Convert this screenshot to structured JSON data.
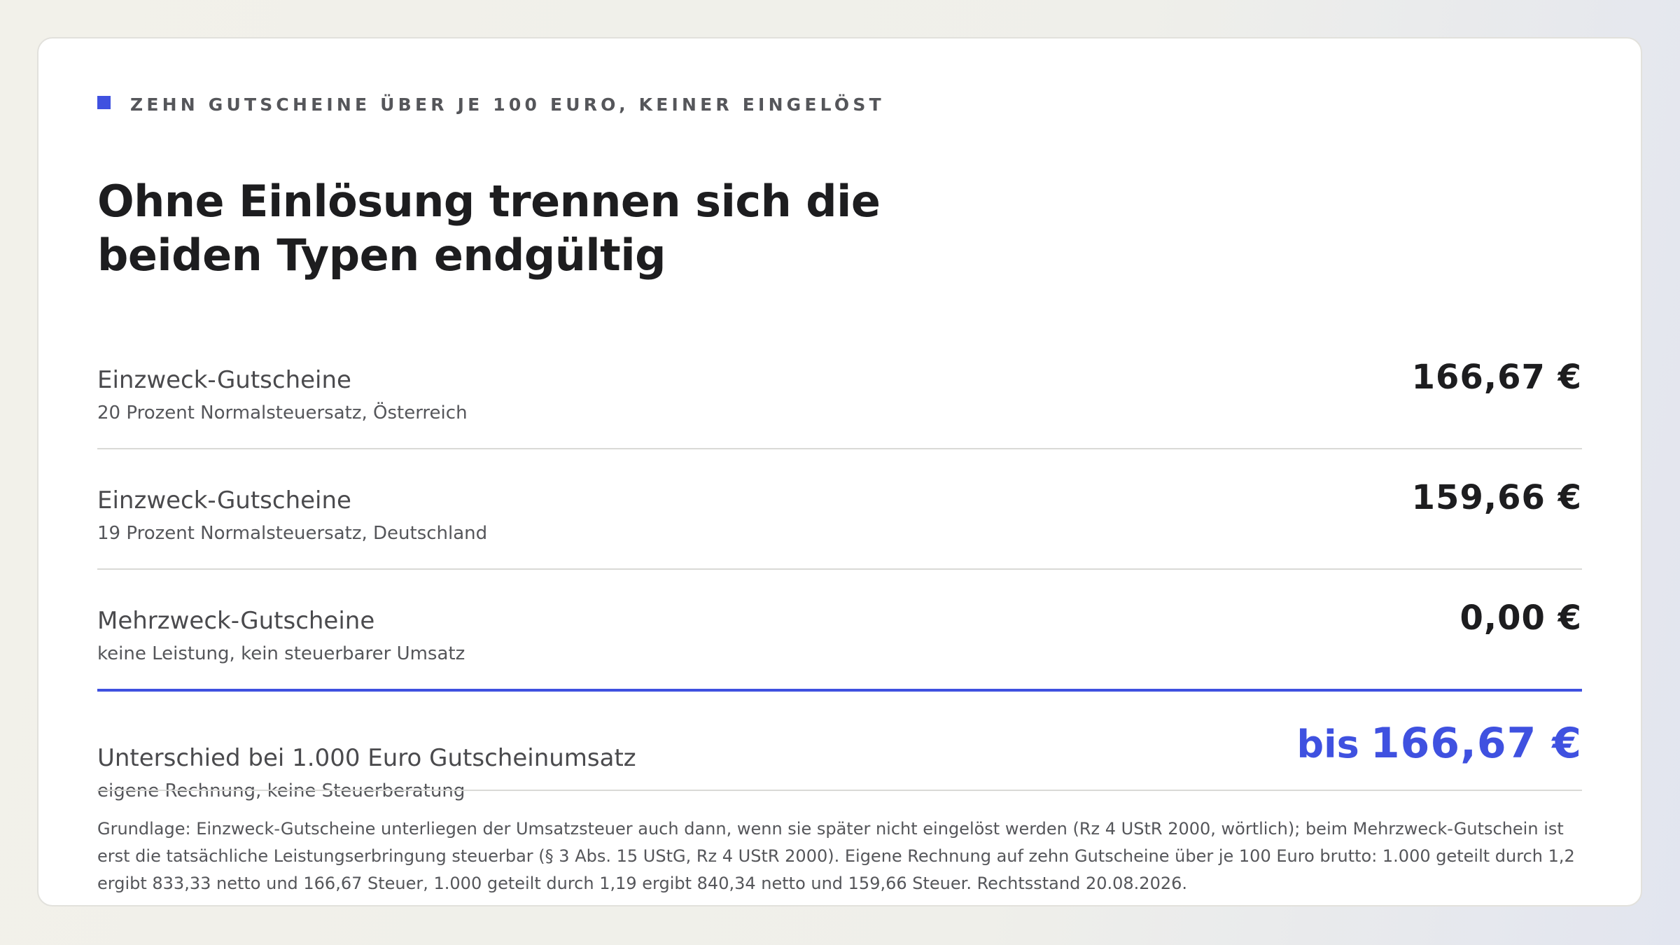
{
  "eyebrow": {
    "text": "ZEHN GUTSCHEINE ÜBER JE 100 EURO, KEINER EINGELÖST",
    "marker_color": "#3f51e0"
  },
  "title": {
    "line1": "Ohne Einlösung trennen sich die",
    "line2": "beiden Typen endgültig"
  },
  "rows": [
    {
      "label": "Einzweck-Gutscheine",
      "sub": "20 Prozent Normalsteuersatz, Österreich",
      "value": "166,67 €"
    },
    {
      "label": "Einzweck-Gutscheine",
      "sub": "19 Prozent Normalsteuersatz, Deutschland",
      "value": "159,66 €"
    },
    {
      "label": "Mehrzweck-Gutscheine",
      "sub": "keine Leistung, kein steuerbarer Umsatz",
      "value": "0,00 €"
    }
  ],
  "total": {
    "label": "Unterschied bei 1.000 Euro Gutscheinumsatz",
    "sub": "eigene Rechnung, keine Steuerberatung",
    "prefix": "bis",
    "amount": "166,67 €",
    "accent_color": "#3f51e0"
  },
  "footnote": "Grundlage: Einzweck-Gutscheine unterliegen der Umsatzsteuer auch dann, wenn sie später nicht eingelöst werden (Rz 4 UStR 2000, wörtlich); beim Mehrzweck-Gutschein ist erst die tatsächliche Leistungserbringung steuerbar (§ 3 Abs. 15 UStG, Rz 4 UStR 2000). Eigene Rechnung auf zehn Gutscheine über je 100 Euro brutto: 1.000 geteilt durch 1,2 ergibt 833,33 netto und 166,67 Steuer, 1.000 geteilt durch 1,19 ergibt 840,34 netto und 159,66 Steuer. Rechtsstand 20.08.2026."
}
